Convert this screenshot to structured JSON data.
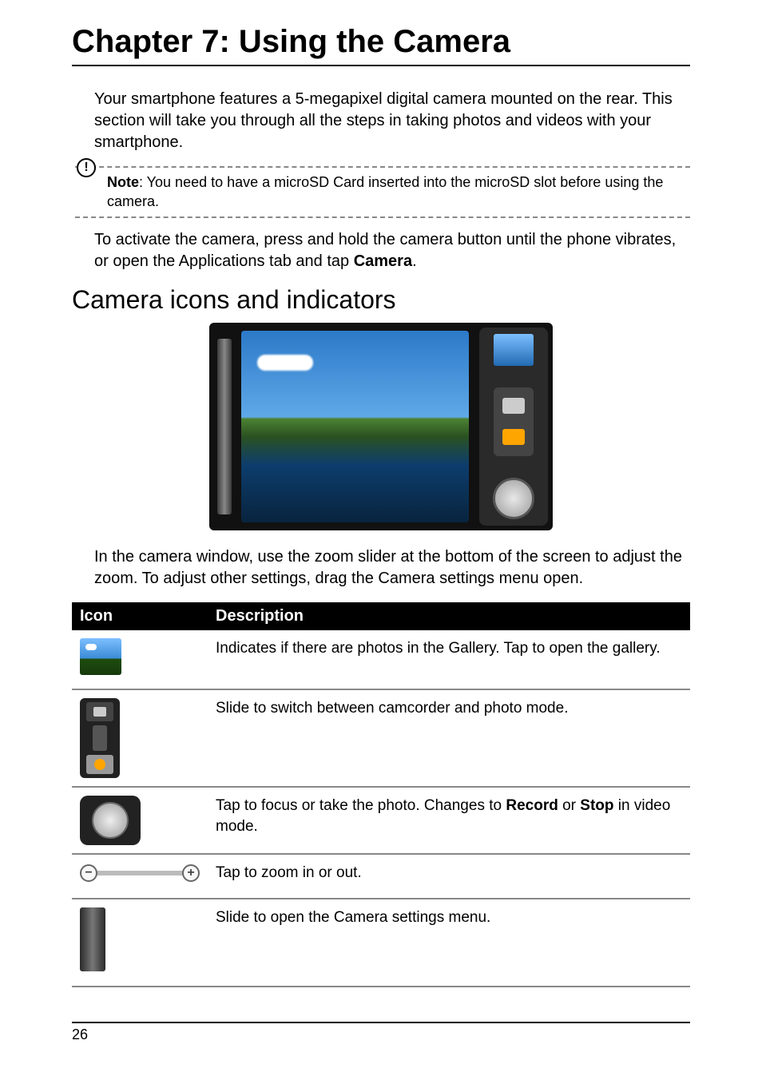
{
  "chapterTitle": "Chapter 7: Using the Camera",
  "intro": "Your smartphone features a 5-megapixel digital camera mounted on the rear. This section will take you through all the steps in taking photos and videos with your smartphone.",
  "note": {
    "label": "Note",
    "text": ": You need to have a microSD Card inserted into the microSD slot before using the camera."
  },
  "activate": {
    "pre": "To activate the camera, press and hold the camera button until the phone vibrates, or open the Applications tab and tap ",
    "bold": "Camera",
    "post": "."
  },
  "sectionTitle": "Camera icons and indicators",
  "caption": "In the camera window, use the zoom slider at the bottom of the screen to adjust the zoom. To adjust other settings, drag the Camera settings menu open.",
  "tableHead": {
    "icon": "Icon",
    "desc": "Description"
  },
  "rows": [
    {
      "desc": "Indicates if there are photos in the Gallery. Tap to open the gallery."
    },
    {
      "desc": "Slide to switch between camcorder and photo mode."
    },
    {
      "pre": "Tap to focus or take the photo. Changes to ",
      "b1": "Record",
      "mid": " or ",
      "b2": "Stop",
      "post": " in video mode."
    },
    {
      "desc": "Tap to zoom in or out."
    },
    {
      "desc": "Slide to open the Camera settings menu."
    }
  ],
  "pageNumber": "26"
}
